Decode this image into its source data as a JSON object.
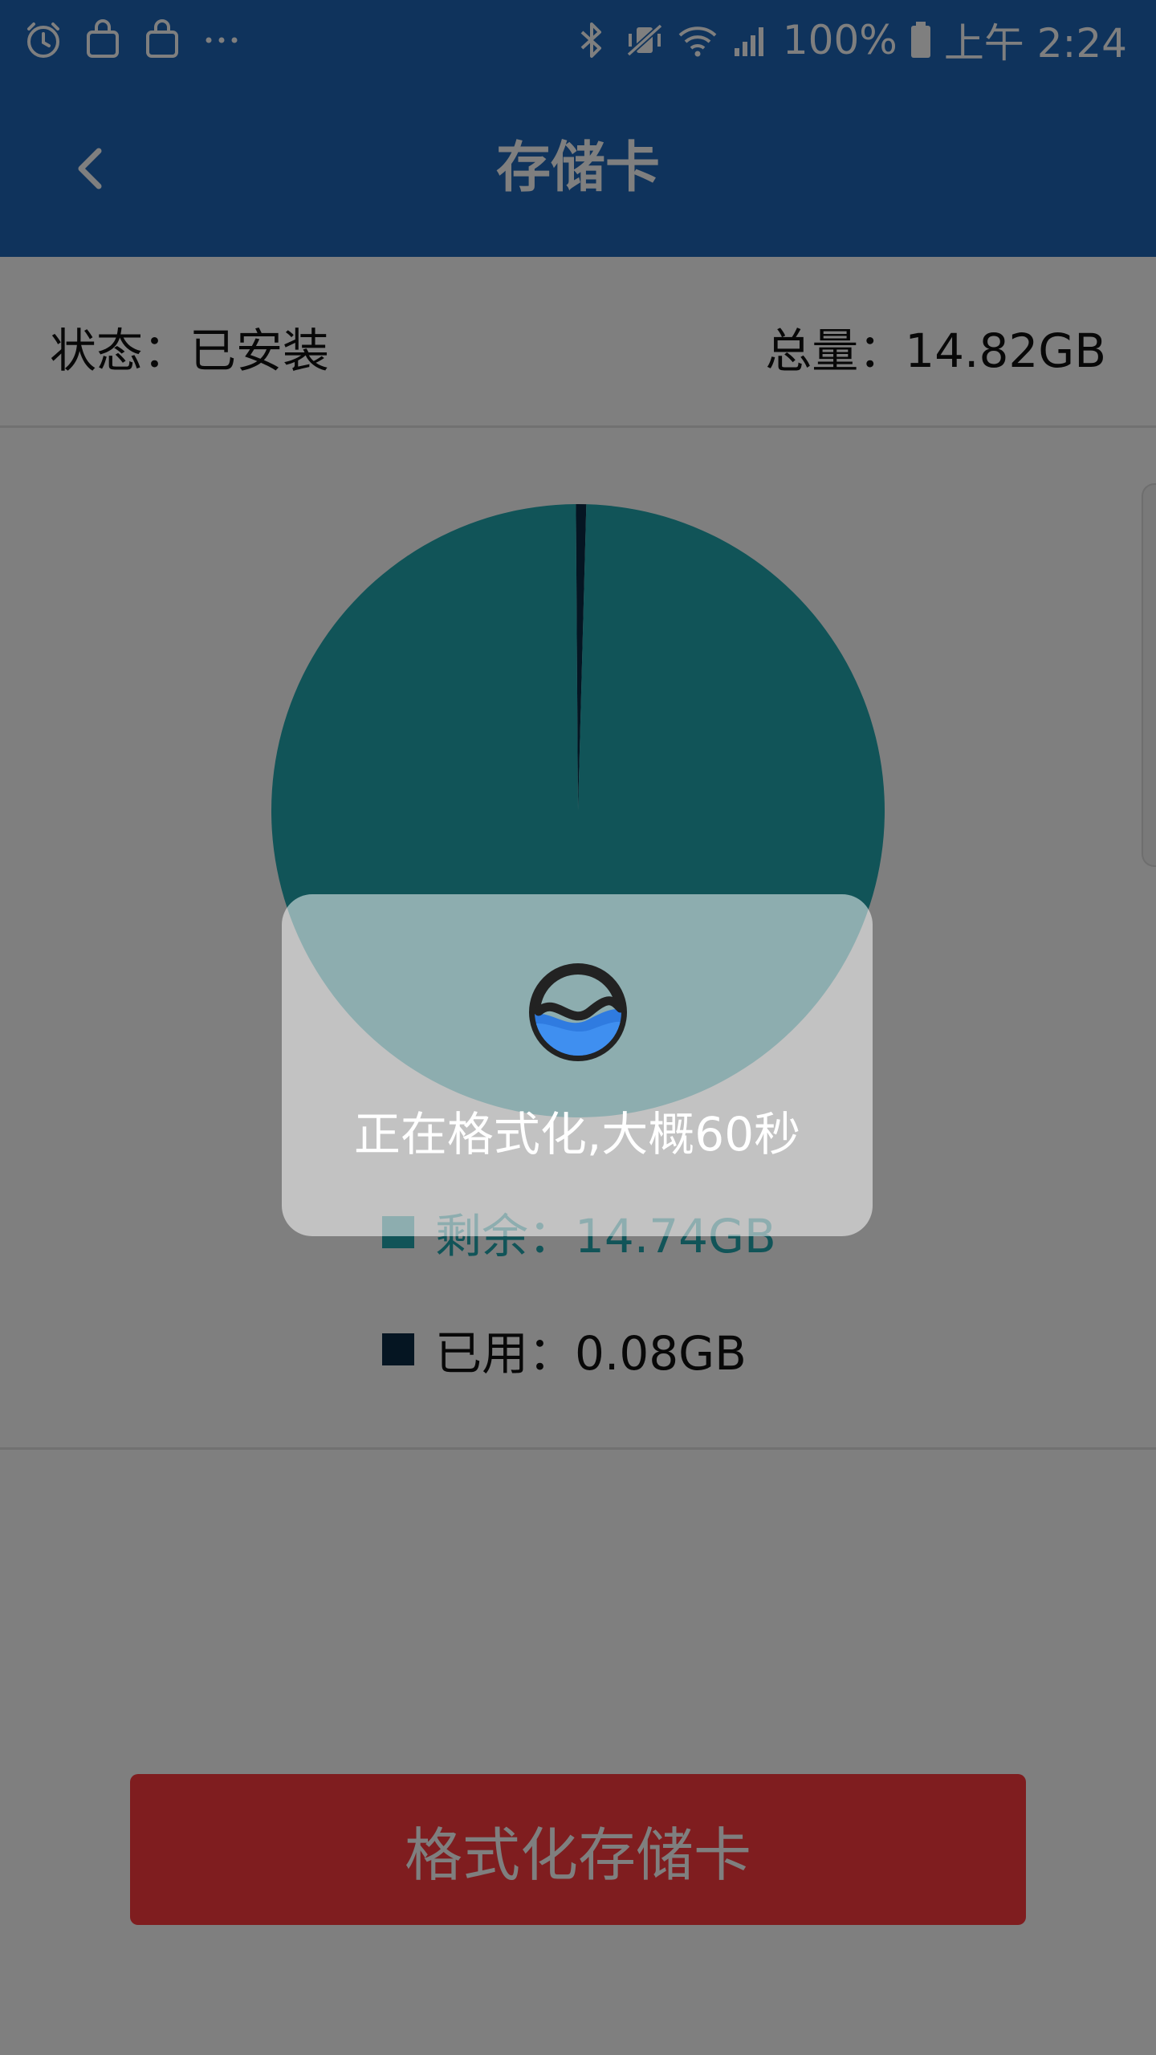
{
  "status_bar": {
    "left_icons": [
      "alarm-icon",
      "shopping-bag-icon",
      "shopping-bag-icon",
      "more-dots-icon"
    ],
    "right_icons": [
      "bluetooth-icon",
      "vibrate-mute-icon",
      "wifi-icon",
      "signal-icon",
      "battery-icon"
    ],
    "battery": "100%",
    "time": "上午 2:24"
  },
  "app_bar": {
    "title": "存储卡",
    "back_icon": "chevron-left-icon"
  },
  "info": {
    "status": "状态：已安装",
    "total": "总量：14.82GB"
  },
  "chart_data": {
    "type": "pie",
    "categories": [
      "剩余",
      "已用"
    ],
    "values": [
      14.74,
      0.08
    ],
    "units": "GB",
    "colors": [
      "#22a8b0",
      "#0a2a44"
    ]
  },
  "legend": {
    "free_label": "剩余：14.74GB",
    "used_label": "已用：0.08GB"
  },
  "format_button": {
    "label": "格式化存储卡"
  },
  "toast": {
    "logo_icon": "app-logo-icon",
    "message": "正在格式化,大概60秒"
  },
  "colors": {
    "app_bar": "#1e66b8",
    "free": "#22a8b0",
    "used": "#0a2a44",
    "format_button": "#ff3b3f"
  }
}
